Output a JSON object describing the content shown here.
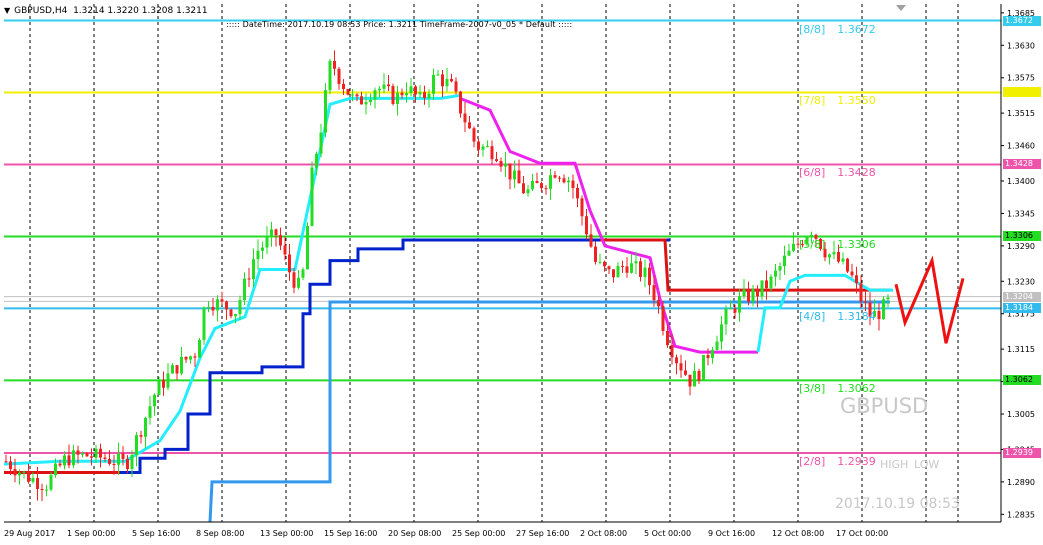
{
  "header": {
    "collapse_icon": "triangle-down-icon",
    "symbol": "GBPUSD,H4",
    "ohlc": "1.3214 1.3220 1.3208 1.3211"
  },
  "info_line": ":::::  DateTime: 2017.10.19 08:53    Price: 1.3211    TimeFrame-2007-v0_05    *    Default    :::::",
  "watermark": {
    "symbol": "GBPUSD",
    "high": "HIGH",
    "low": "LOW",
    "datetime": "2017.10.19 08:53"
  },
  "chart_data": {
    "type": "candlestick",
    "symbol": "GBPUSD",
    "timeframe": "H4",
    "ylim": [
      1.2822,
      1.37
    ],
    "y_ticks": [
      "1.3685",
      "1.3630",
      "1.3575",
      "1.3515",
      "1.3460",
      "1.3400",
      "1.3345",
      "1.3290",
      "1.3230",
      "1.3175",
      "1.3115",
      "1.3060",
      "1.3005",
      "1.2945",
      "1.2890",
      "1.2835"
    ],
    "x_ticks": [
      "29 Aug 2017",
      "1 Sep 00:00",
      "5 Sep 16:00",
      "8 Sep 08:00",
      "13 Sep 00:00",
      "15 Sep 16:00",
      "20 Sep 08:00",
      "25 Sep 00:00",
      "27 Sep 16:00",
      "2 Oct 08:00",
      "5 Oct 00:00",
      "9 Oct 16:00",
      "12 Oct 08:00",
      "17 Oct 00:00"
    ],
    "murrey_levels": [
      {
        "label": "[8/8]",
        "value": "1.3672",
        "price": 1.3672,
        "color": "#33ccee"
      },
      {
        "label": "[7/8]",
        "value": "1.3550",
        "price": 1.355,
        "color": "#f0f000"
      },
      {
        "label": "[6/8]",
        "value": "1.3428",
        "price": 1.3428,
        "color": "#ee55aa"
      },
      {
        "label": "[5/8]",
        "value": "1.3306",
        "price": 1.3306,
        "color": "#22dd22"
      },
      {
        "label": "[4/8]",
        "value": "1.3184",
        "price": 1.3184,
        "color": "#33bbee"
      },
      {
        "label": "[3/8]",
        "value": "1.3062",
        "price": 1.3062,
        "color": "#22dd22"
      },
      {
        "label": "[2/8]",
        "value": "1.2939",
        "price": 1.2939,
        "color": "#ee55aa"
      }
    ],
    "price_tags": [
      {
        "text": "1.3204",
        "price": 1.3204,
        "bg": "#c0c0c0",
        "fg": "#ffffff"
      },
      {
        "text": "1.3672",
        "price": 1.3672,
        "bg": "#33ccee",
        "fg": "#ffffff"
      },
      {
        "text": "1.3550",
        "price": 1.355,
        "bg": "#f0f000",
        "fg": "#f0f000"
      },
      {
        "text": "1.3428",
        "price": 1.3428,
        "bg": "#ee55aa",
        "fg": "#ffffff"
      },
      {
        "text": "1.3306",
        "price": 1.3306,
        "bg": "#22dd22",
        "fg": "#000000"
      },
      {
        "text": "1.3184",
        "price": 1.3184,
        "bg": "#33bbee",
        "fg": "#ffffff"
      },
      {
        "text": "1.3062",
        "price": 1.3062,
        "bg": "#22dd22",
        "fg": "#000000"
      },
      {
        "text": "1.2939",
        "price": 1.2939,
        "bg": "#ee55aa",
        "fg": "#ffffff"
      }
    ],
    "grid": "dashed vertical",
    "colors": {
      "up": "#22dd22",
      "down": "#ee2222",
      "cyan_line": "#22eeff",
      "magenta_line": "#ee22ee",
      "blue_step": "#0022cc",
      "lightblue_step": "#3399ee",
      "red_step": "#dd1111",
      "projection": "#ee1111"
    }
  }
}
